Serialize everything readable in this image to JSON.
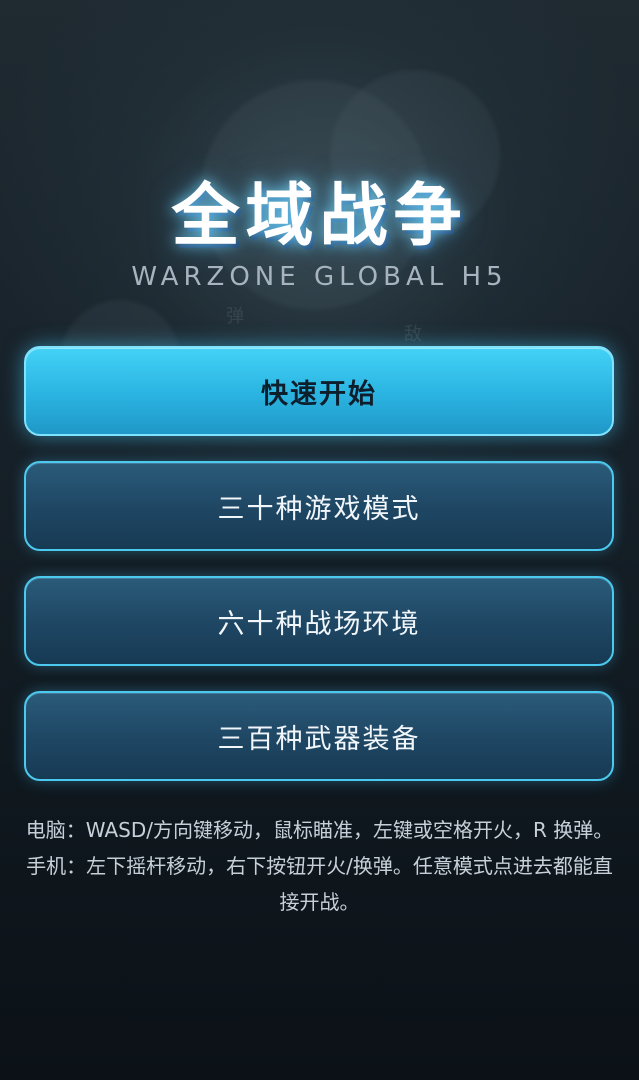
{
  "game": {
    "title": "全域战争",
    "subtitle": "WARZONE GLOBAL H5"
  },
  "menu": {
    "items": [
      {
        "label": "快速开始",
        "primary": true
      },
      {
        "label": "三十种游戏模式",
        "primary": false
      },
      {
        "label": "六十种战场环境",
        "primary": false
      },
      {
        "label": "三百种武器装备",
        "primary": false
      }
    ]
  },
  "controls_hint": "电脑：WASD/方向键移动，鼠标瞄准，左键或空格开火，R 换弹。手机：左下摇杆移动，右下按钮开火/换弹。任意模式点进去都能直接开战。",
  "background_glyphs": [
    "弹",
    "敌"
  ],
  "colors": {
    "accent": "#4cc9ee",
    "primary_button": "#2cb6e3",
    "secondary_button": "#1e4663",
    "background": "#111a21"
  }
}
